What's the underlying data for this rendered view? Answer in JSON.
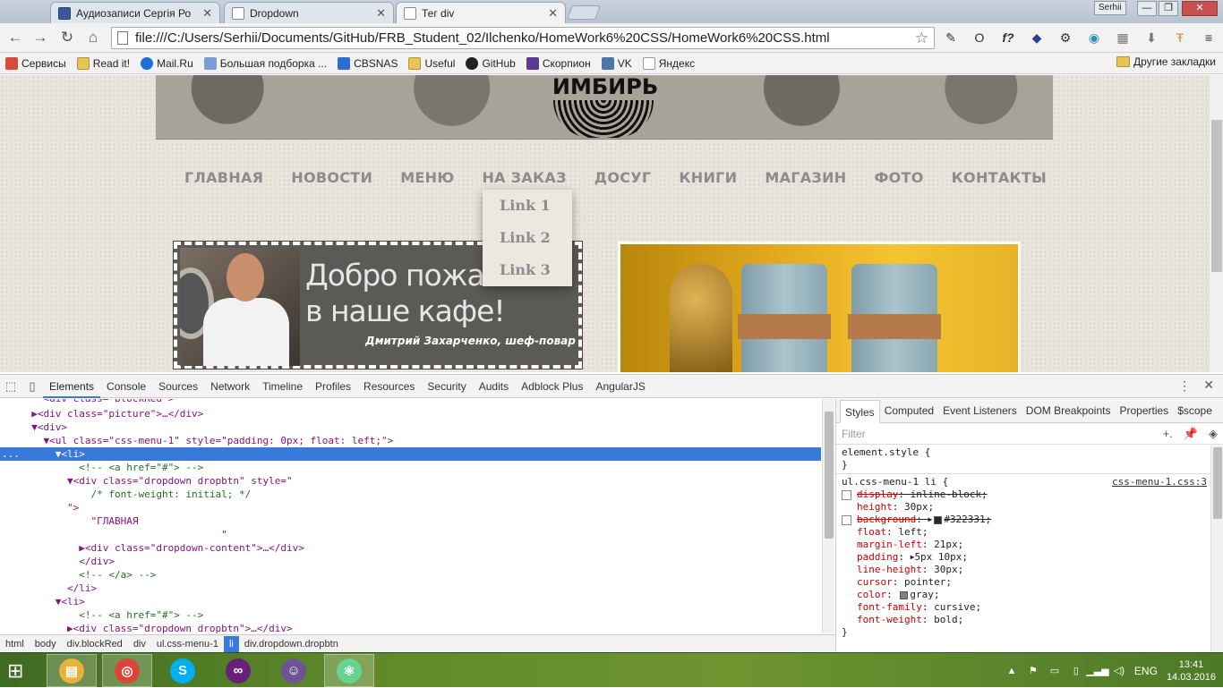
{
  "tabs": [
    {
      "title": "Аудиозаписи Сергія Ро",
      "icon": "vk-icon"
    },
    {
      "title": "Dropdown",
      "icon": "page-icon"
    },
    {
      "title": "Тег div",
      "icon": "page-icon",
      "active": true
    }
  ],
  "window": {
    "user": "Serhii",
    "minimize": "—",
    "restore": "❐",
    "close": "✕"
  },
  "toolbar": {
    "back": "←",
    "forward": "→",
    "reload": "↻",
    "home": "⌂",
    "url": "file:///C:/Users/Serhii/Documents/GitHub/FRB_Student_02/Ilchenko/HomeWork6%20CSS/HomeWork6%20CSS.html",
    "star": "☆",
    "extensions": [
      "dropper-icon",
      "opera-icon",
      "fx-icon",
      "shield-icon",
      "gear-icon",
      "wave-icon",
      "grid-icon",
      "download-icon",
      "t-icon",
      "menu-icon"
    ]
  },
  "bookmarks": [
    {
      "label": "Сервисы",
      "icon": "apps-icon",
      "color": "#d64b3a"
    },
    {
      "label": "Read it!",
      "icon": "folder-icon",
      "color": "#e8c35a"
    },
    {
      "label": "Mail.Ru",
      "icon": "mailru-icon",
      "color": "#1e6fd9"
    },
    {
      "label": "Большая подборка ...",
      "icon": "doc-icon",
      "color": "#7b9fd4"
    },
    {
      "label": "CBSNAS",
      "icon": "nas-icon",
      "color": "#2b6fd6"
    },
    {
      "label": "Useful",
      "icon": "folder-icon",
      "color": "#e8c35a"
    },
    {
      "label": "GitHub",
      "icon": "github-icon",
      "color": "#222222"
    },
    {
      "label": "Скорпион",
      "icon": "scorpion-icon",
      "color": "#5a3b8f"
    },
    {
      "label": "VK",
      "icon": "vk-icon",
      "color": "#4a76a8"
    },
    {
      "label": "Яндекс",
      "icon": "page-icon",
      "color": "#ffffff"
    }
  ],
  "other_bookmarks": "Другие закладки",
  "site": {
    "logo": "ИМБИРЬ",
    "menu": [
      "ГЛАВНАЯ",
      "НОВОСТИ",
      "МЕНЮ",
      "НА ЗАКАЗ",
      "ДОСУГ",
      "КНИГИ",
      "МАГАЗИН",
      "ФОТО",
      "КОНТАКТЫ"
    ],
    "dropdown": [
      "Link 1",
      "Link 2",
      "Link 3"
    ],
    "welcome_line1": "Добро пожалов",
    "welcome_line2": "в наше кафе!",
    "welcome_sign": "Дмитрий Захарченко, шеф-повар"
  },
  "devtools": {
    "tabs": [
      "Elements",
      "Console",
      "Sources",
      "Network",
      "Timeline",
      "Profiles",
      "Resources",
      "Security",
      "Audits",
      "Adblock Plus",
      "AngularJS"
    ],
    "active_tab": "Elements",
    "more": "⋮",
    "close": "✕",
    "dom_lines": [
      {
        "text": "    <div class=\"blockRed\">",
        "cut": true
      },
      {
        "text": "  ▶<div class=\"picture\">…</div>"
      },
      {
        "text": "  ▼<div>"
      },
      {
        "text": "    ▼<ul class=\"css-menu-1\" style=\"padding: 0px; float: left;\">"
      },
      {
        "text": "      ▼<li>",
        "selected": true,
        "gutter": "..."
      },
      {
        "text": "          <!-- <a href=\"#\"> -->"
      },
      {
        "text": "        ▼<div class=\"dropdown dropbtn\" style=\""
      },
      {
        "text": "            /* font-weight: initial; */"
      },
      {
        "text": "        \">"
      },
      {
        "text": "            \"ГЛАВНАЯ"
      },
      {
        "text": "                                  \""
      },
      {
        "text": "          ▶<div class=\"dropdown-content\">…</div>"
      },
      {
        "text": "          </div>"
      },
      {
        "text": "          <!-- </a> -->"
      },
      {
        "text": "        </li>"
      },
      {
        "text": "      ▼<li>"
      },
      {
        "text": "          <!-- <a href=\"#\"> -->"
      },
      {
        "text": "        ▶<div class=\"dropdown dropbtn\">…</div>"
      }
    ],
    "breadcrumb": [
      "html",
      "body",
      "div.blockRed",
      "div",
      "ul.css-menu-1",
      "li",
      "div.dropdown.dropbtn"
    ],
    "breadcrumb_active": "li",
    "styles_tabs": [
      "Styles",
      "Computed",
      "Event Listeners",
      "DOM Breakpoints",
      "Properties",
      "$scope"
    ],
    "styles_active": "Styles",
    "filter_placeholder": "Filter",
    "element_style_open": "element.style {",
    "element_style_close": "}",
    "rule_selector": "ul.css-menu-1 li {",
    "rule_source": "css-menu-1.css:3",
    "rule_props": [
      {
        "name": "display",
        "value": "inline-block;",
        "struck": true,
        "checkbox": true
      },
      {
        "name": "height",
        "value": "30px;"
      },
      {
        "name": "background",
        "value": "#322331;",
        "struck": true,
        "checkbox": true,
        "swatch": "#322331",
        "expand": true
      },
      {
        "name": "float",
        "value": "left;"
      },
      {
        "name": "margin-left",
        "value": "21px;"
      },
      {
        "name": "padding",
        "value": "5px 10px;",
        "expand": true
      },
      {
        "name": "line-height",
        "value": "30px;"
      },
      {
        "name": "cursor",
        "value": "pointer;"
      },
      {
        "name": "color",
        "value": "gray;",
        "swatch": "#808080"
      },
      {
        "name": "font-family",
        "value": "cursive;"
      },
      {
        "name": "font-weight",
        "value": "bold;"
      }
    ],
    "rule_close": "}"
  },
  "taskbar": {
    "start": "⊞",
    "apps": [
      {
        "name": "explorer-icon",
        "color": "#e8b23a",
        "open": true
      },
      {
        "name": "chrome-icon",
        "color": "#db4437",
        "open": true
      },
      {
        "name": "skype-icon",
        "color": "#00aff0",
        "open": false
      },
      {
        "name": "visual-studio-icon",
        "color": "#68217a",
        "open": false
      },
      {
        "name": "github-desktop-icon",
        "color": "#6e5494",
        "open": false
      },
      {
        "name": "atom-icon",
        "color": "#66d28f",
        "open": true
      }
    ],
    "tray": [
      "chevron-up-icon",
      "flag-icon",
      "battery-icon",
      "network-icon",
      "signal-icon",
      "volume-icon"
    ],
    "lang": "ENG",
    "time": "13:41",
    "date": "14.03.2016"
  }
}
